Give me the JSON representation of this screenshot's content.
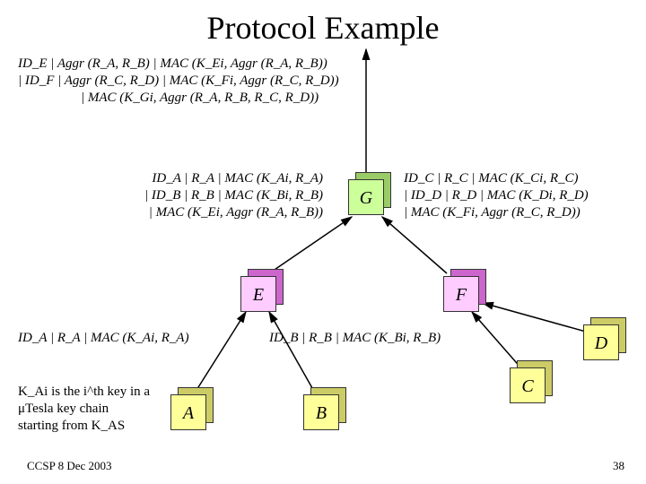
{
  "title": "Protocol Example",
  "footer": {
    "left": "CCSP 8 Dec 2003",
    "right": "38"
  },
  "nodes": {
    "G": "G",
    "E": "E",
    "F": "F",
    "A": "A",
    "B": "B",
    "C": "C",
    "D": "D"
  },
  "messages": {
    "top1": "ID_E | Aggr (R_A, R_B) | MAC (K_Ei, Aggr (R_A, R_B))",
    "top2": "| ID_F | Aggr (R_C, R_D) | MAC (K_Fi, Aggr (R_C, R_D))",
    "top3": "| MAC (K_Gi, Aggr (R_A, R_B, R_C, R_D))",
    "left1": "ID_A | R_A | MAC (K_Ai, R_A)",
    "left2": "| ID_B | R_B | MAC (K_Bi, R_B)",
    "left3": "| MAC (K_Ei, Aggr (R_A, R_B))",
    "right1": "ID_C | R_C | MAC (K_Ci, R_C)",
    "right2": "| ID_D | R_D | MAC (K_Di, R_D)",
    "right3": "| MAC (K_Fi, Aggr (R_C, R_D))",
    "bottomLeft": "ID_A | R_A | MAC (K_Ai, R_A)",
    "bottomMid": "ID_B | R_B | MAC (K_Bi, R_B)"
  },
  "note": {
    "l1": "K_Ai is the i^th key in a",
    "l2": "μTesla key chain",
    "l3": "starting from K_AS"
  },
  "chart_data": {
    "type": "tree",
    "nodes": [
      "G",
      "E",
      "F",
      "A",
      "B",
      "C",
      "D"
    ],
    "edges": [
      {
        "from": "A",
        "to": "E",
        "label": "ID_A | R_A | MAC (K_Ai, R_A)"
      },
      {
        "from": "B",
        "to": "E",
        "label": "ID_B | R_B | MAC (K_Bi, R_B)"
      },
      {
        "from": "C",
        "to": "F"
      },
      {
        "from": "D",
        "to": "F"
      },
      {
        "from": "E",
        "to": "G",
        "label": "ID_A|R_A|MAC(K_Ai,R_A) | ID_B|R_B|MAC(K_Bi,R_B) | MAC(K_Ei,Aggr(R_A,R_B))"
      },
      {
        "from": "F",
        "to": "G",
        "label": "ID_C|R_C|MAC(K_Ci,R_C) | ID_D|R_D|MAC(K_Di,R_D) | MAC(K_Fi,Aggr(R_C,R_D))"
      },
      {
        "from": "G",
        "to": "root",
        "label": "ID_E|Aggr(R_A,R_B)|MAC(K_Ei,...) | ID_F|Aggr(R_C,R_D)|MAC(K_Fi,...) | MAC(K_Gi,Aggr(R_A,R_B,R_C,R_D))"
      }
    ]
  }
}
